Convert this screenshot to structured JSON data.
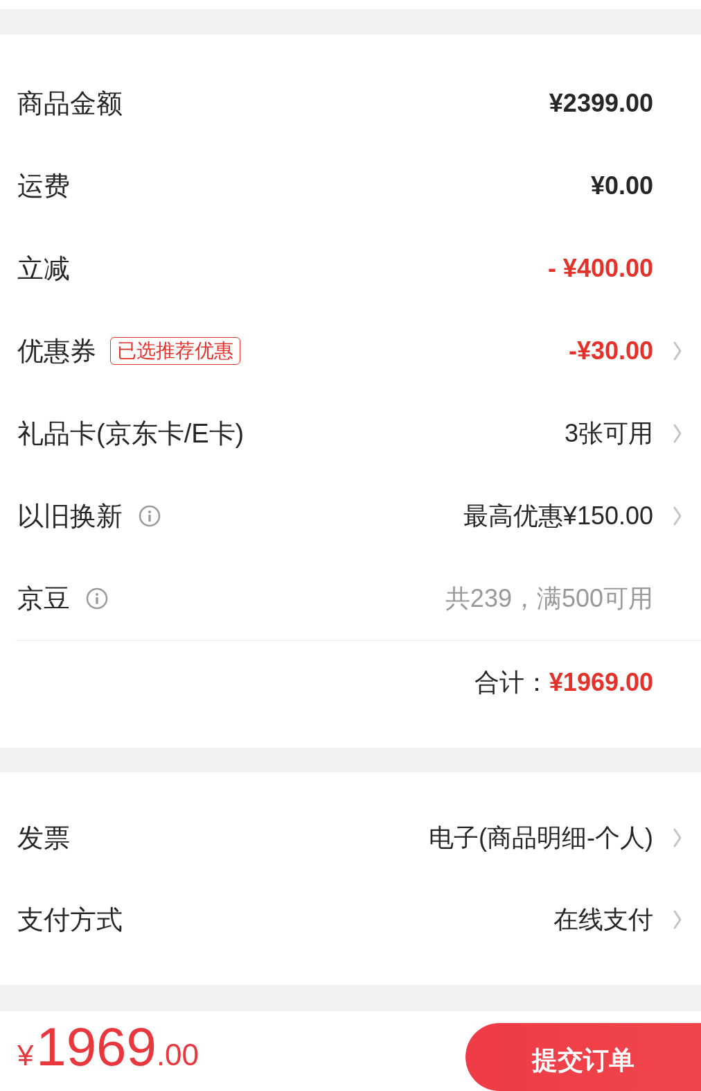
{
  "price_rows": [
    {
      "label": "商品金额",
      "value": "¥2399.00",
      "kind": "strong",
      "chevron": false,
      "info": false
    },
    {
      "label": "运费",
      "value": "¥0.00",
      "kind": "strong",
      "chevron": false,
      "info": false
    },
    {
      "label": "立减",
      "value": "- ¥400.00",
      "kind": "discount",
      "chevron": false,
      "info": false
    },
    {
      "label": "优惠券",
      "badge": "已选推荐优惠",
      "value": "-¥30.00",
      "kind": "discount",
      "chevron": true,
      "info": false
    },
    {
      "label": "礼品卡(京东卡/E卡)",
      "value": "3张可用",
      "kind": "plain",
      "chevron": true,
      "info": false
    },
    {
      "label": "以旧换新",
      "value": "最高优惠¥150.00",
      "kind": "plain",
      "chevron": true,
      "info": true
    },
    {
      "label": "京豆",
      "value": "共239，满500可用",
      "kind": "muted",
      "chevron": false,
      "info": true
    }
  ],
  "total": {
    "label": "合计：",
    "value": "¥1969.00"
  },
  "option_rows": [
    {
      "label": "发票",
      "value": "电子(商品明细-个人)",
      "kind": "plain",
      "chevron": true,
      "info": false
    },
    {
      "label": "支付方式",
      "value": "在线支付",
      "kind": "plain",
      "chevron": true,
      "info": false
    }
  ],
  "bottom_bar": {
    "currency": "¥",
    "amount_integer": "1969",
    "amount_decimal": ".00",
    "submit_button": "提交订单"
  }
}
